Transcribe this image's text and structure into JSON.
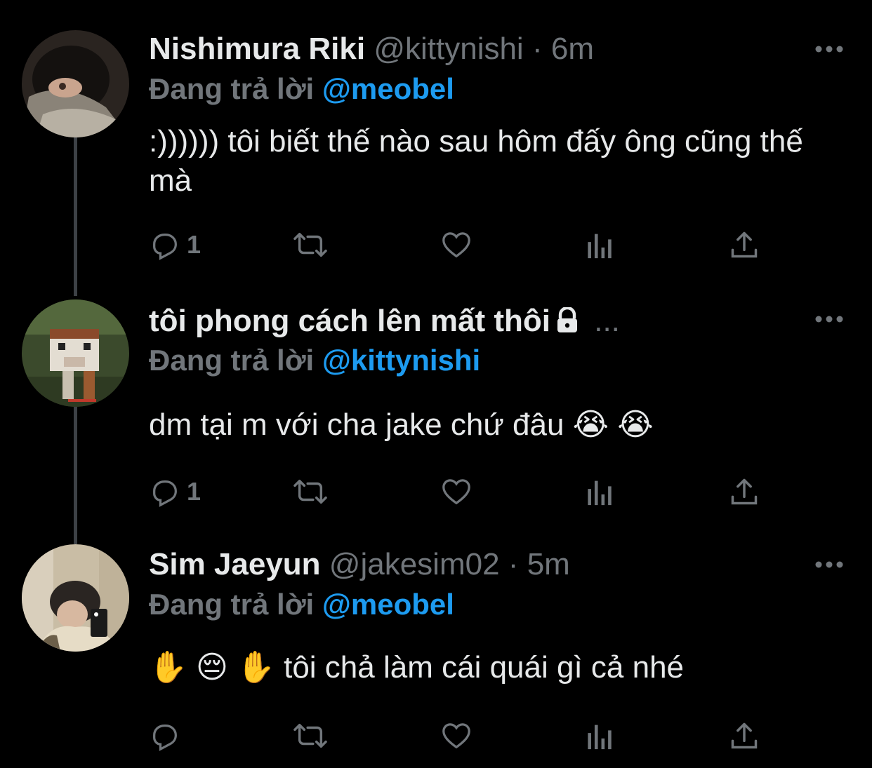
{
  "tweets": [
    {
      "name": "Nishimura Riki",
      "handle": "@kittynishi",
      "dot": "·",
      "time": "6m",
      "replying_label": "Đang trả lời",
      "replying_to": "@meobel",
      "text": ":)))))) tôi biết thế nào sau hôm đấy ông cũng thế mà",
      "reply_count": "1",
      "avatar_icon": "avatar-photo"
    },
    {
      "name": "tôi phong cách lên mất thôi",
      "handle": "...",
      "dot": "",
      "time": "",
      "protected": true,
      "replying_label": "Đang trả lời",
      "replying_to": "@kittynishi",
      "text": "dm tại m với cha jake chứ đâu 😭 😭",
      "reply_count": "1",
      "avatar_icon": "avatar-cow"
    },
    {
      "name": "Sim Jaeyun",
      "handle": "@jakesim02",
      "dot": "·",
      "time": "5m",
      "replying_label": "Đang trả lời",
      "replying_to": "@meobel",
      "text": "✋ 😔 ✋  tôi chả làm cái quái gì cả nhé",
      "reply_count": "",
      "avatar_icon": "avatar-photo"
    }
  ],
  "icons": {
    "reply": "reply-icon",
    "retweet": "retweet-icon",
    "like": "heart-icon",
    "analytics": "analytics-icon",
    "share": "share-icon",
    "more": "more-icon",
    "lock": "lock-icon"
  },
  "colors": {
    "background": "#000000",
    "text": "#e7e9ea",
    "secondary": "#71767b",
    "accent": "#1d9bf0",
    "thread_line": "#3d4146"
  }
}
